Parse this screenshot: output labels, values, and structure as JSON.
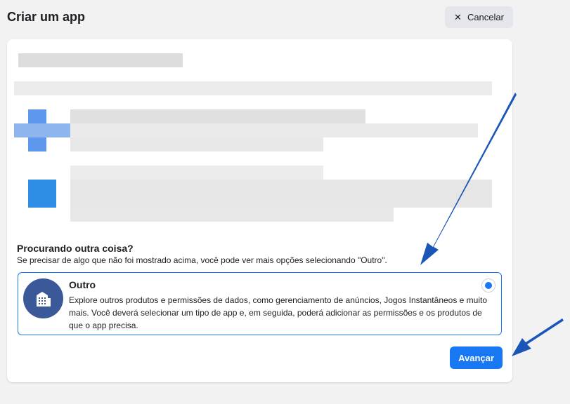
{
  "header": {
    "title": "Criar um app",
    "cancel_label": "Cancelar"
  },
  "section": {
    "heading": "Procurando outra coisa?",
    "subtext": "Se precisar de algo que não foi mostrado acima, você pode ver mais opções selecionando \"Outro\"."
  },
  "option": {
    "title": "Outro",
    "description": "Explore outros produtos e permissões de dados, como gerenciamento de anúncios, Jogos Instantâneos e muito mais. Você deverá selecionar um tipo de app e, em seguida, poderá adicionar as permissões e os produtos de que o app precisa.",
    "selected": true
  },
  "footer": {
    "next_label": "Avançar"
  },
  "colors": {
    "accent": "#1877f2",
    "icon_bg": "#3b5998",
    "arrow": "#1a56b8"
  }
}
